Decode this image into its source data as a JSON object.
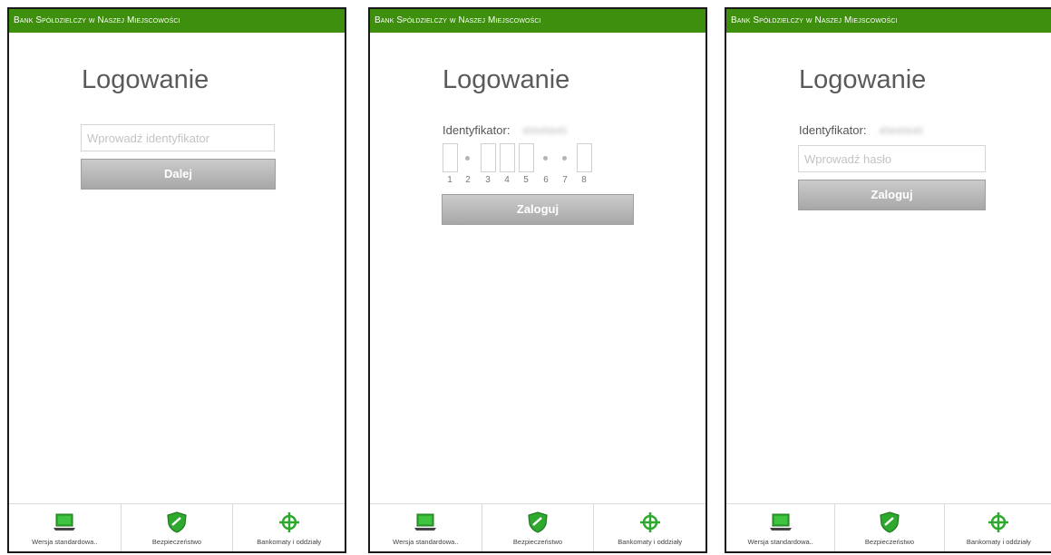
{
  "screens": [
    {
      "bank_name": "Bank Spółdzielczy w Naszej Miejscowości",
      "title": "Logowanie",
      "id_placeholder": "Wprowadź identyfikator",
      "button_label": "Dalej"
    },
    {
      "bank_name": "Bank Spółdzielczy w Naszej Miejscowości",
      "title": "Logowanie",
      "id_label": "Identyfikator:",
      "id_value": "45645645",
      "pin_numbers": [
        "1",
        "2",
        "3",
        "4",
        "5",
        "6",
        "7",
        "8"
      ],
      "button_label": "Zaloguj"
    },
    {
      "bank_name": "Bank Spółdzielczy w Naszej Miejscowości",
      "title": "Logowanie",
      "id_label": "Identyfikator:",
      "id_value": "45645645",
      "password_placeholder": "Wprowadź hasło",
      "button_label": "Zaloguj"
    }
  ],
  "footer": {
    "standard_version": "Wersja standardowa..",
    "security": "Bezpieczeństwo",
    "atms": "Bankomaty i oddziały"
  },
  "colors": {
    "brand_green": "#3e8f0e",
    "icon_green": "#2ea82e",
    "button_gray": "#b5b5b5"
  },
  "icons": [
    "laptop-icon",
    "shield-icon",
    "crosshair-icon"
  ]
}
